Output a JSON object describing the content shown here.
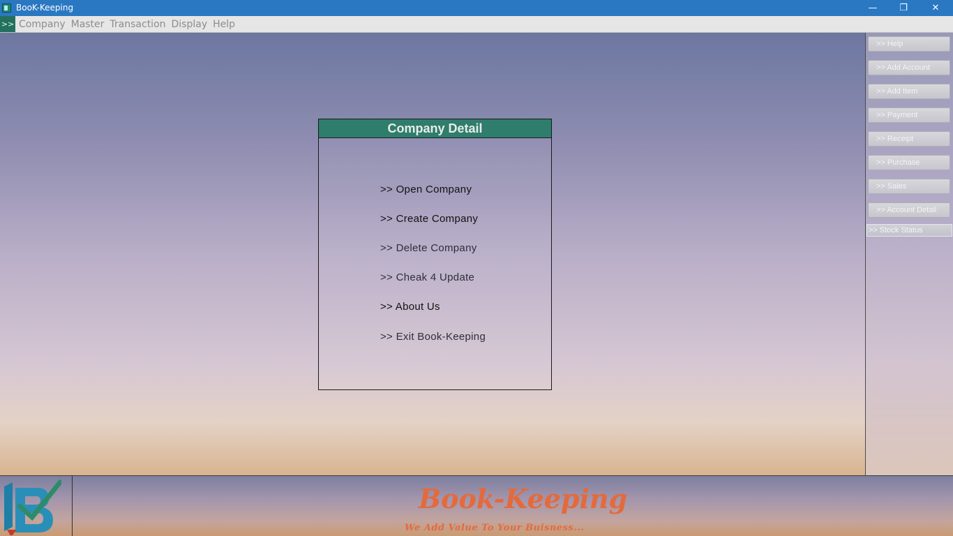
{
  "window": {
    "title": "BooK-Keeping",
    "controls": {
      "minimize": "—",
      "restore": "❐",
      "close": "✕"
    }
  },
  "menubar": {
    "marker": ">>",
    "items": [
      "Company",
      "Master",
      "Transaction",
      "Display",
      "Help"
    ]
  },
  "panel": {
    "title": "Company Detail",
    "links": [
      ">> Open Company",
      ">> Create Company",
      ">> Delete Company",
      ">> Cheak 4 Update",
      ">> About Us",
      ">> Exit Book-Keeping"
    ]
  },
  "sidebar": {
    "buttons": [
      ">> Help",
      ">> Add Account",
      ">> Add Item",
      ">> Payment",
      ">> Receipt",
      ">> Purchase",
      ">> Sales",
      ">> Account Detail",
      ">> Stock Status"
    ]
  },
  "footer": {
    "brand": "Book-Keeping",
    "tagline": "We Add Value To Your Buisness..."
  },
  "colors": {
    "accent": "#2f7d6c",
    "brand": "#e46a3c",
    "titlebar": "#2a78c2"
  }
}
